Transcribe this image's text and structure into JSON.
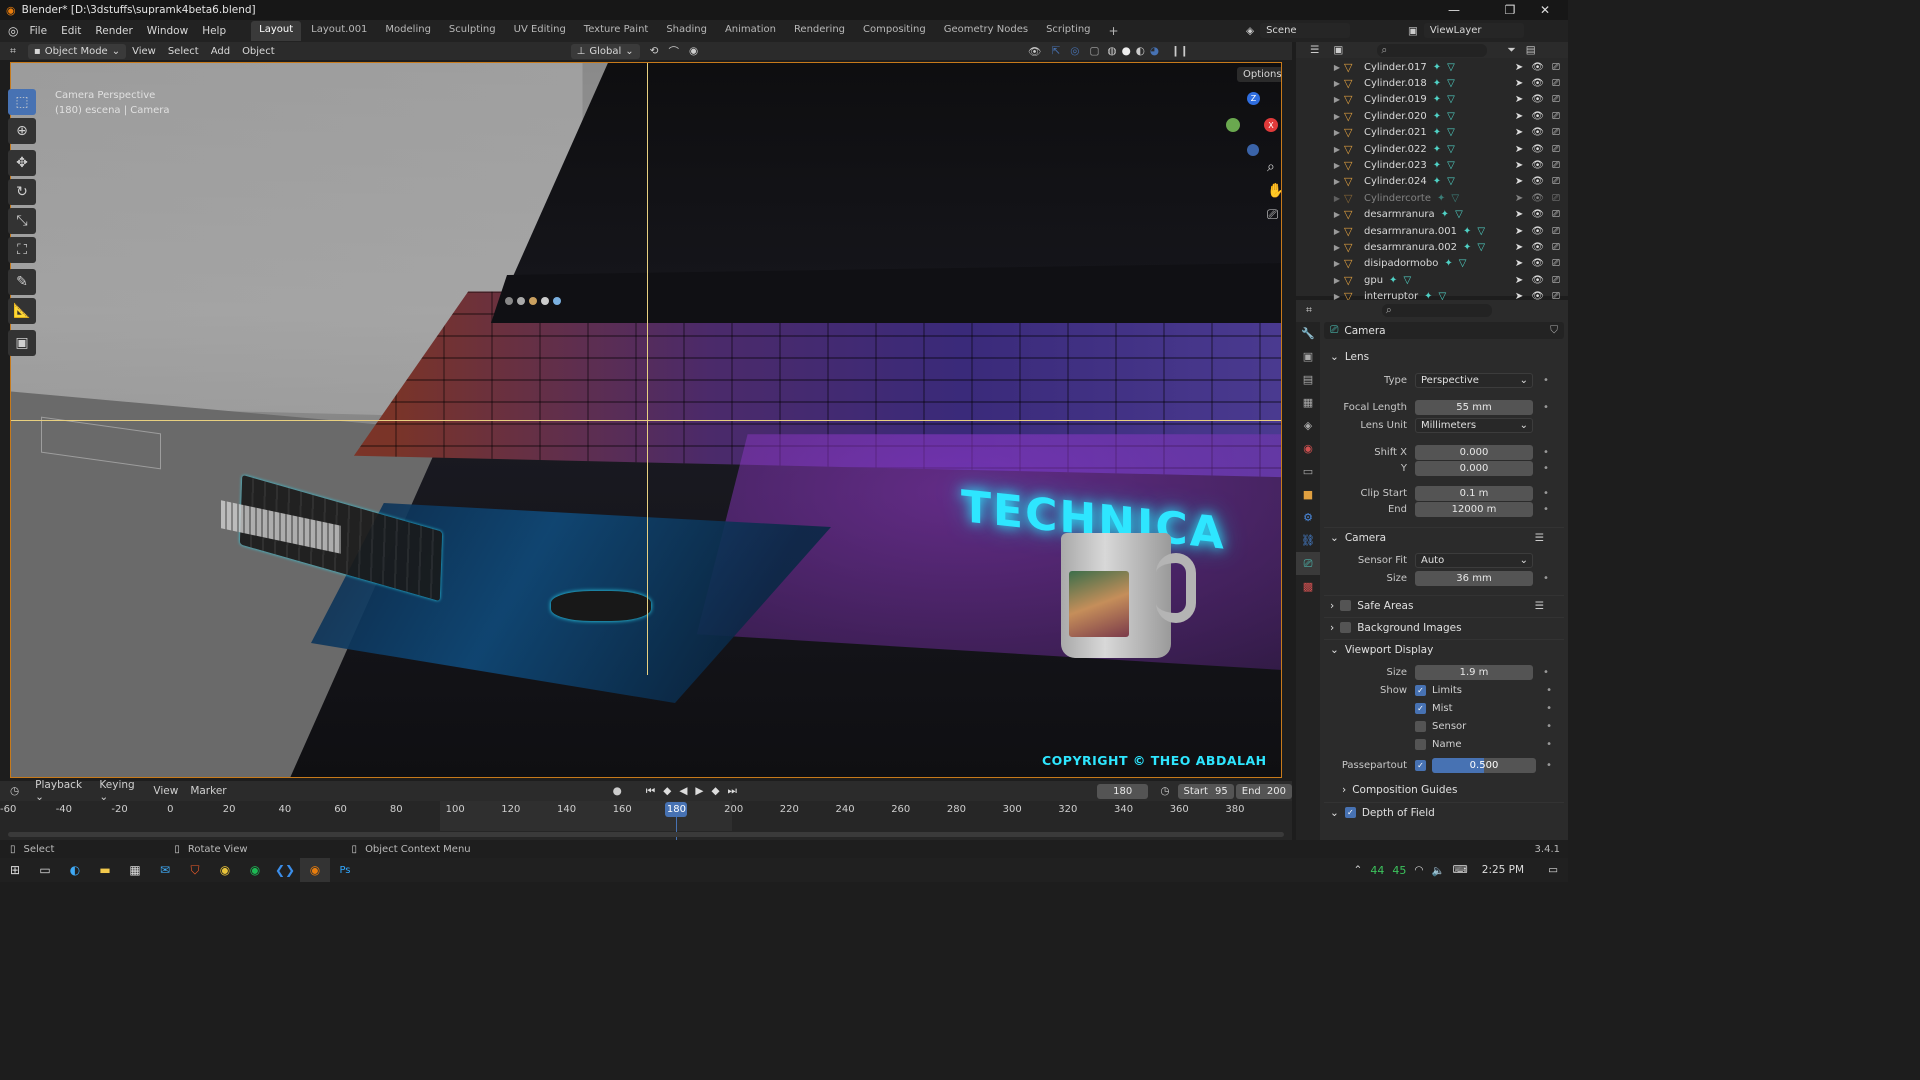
{
  "window": {
    "title": "Blender* [D:\\3dstuffs\\supramk4beta6.blend]"
  },
  "menu": {
    "items": [
      "File",
      "Edit",
      "Render",
      "Window",
      "Help"
    ]
  },
  "workspaces": [
    "Layout",
    "Layout.001",
    "Modeling",
    "Sculpting",
    "UV Editing",
    "Texture Paint",
    "Shading",
    "Animation",
    "Rendering",
    "Compositing",
    "Geometry Nodes",
    "Scripting"
  ],
  "active_workspace": "Layout",
  "scene": {
    "label": "Scene",
    "viewlayer": "ViewLayer"
  },
  "viewport_header": {
    "mode": "Object Mode",
    "menus": [
      "View",
      "Select",
      "Add",
      "Object"
    ],
    "orientation": "Global",
    "options_label": "Options"
  },
  "viewport": {
    "overlay_line1": "Camera Perspective",
    "overlay_line2": "(180) escena | Camera",
    "copyright": "COPYRIGHT © THEO ABDALAH",
    "sign_text": "TECHNICA",
    "gizmo": {
      "z": "Z",
      "x": "X"
    }
  },
  "outliner": {
    "items": [
      {
        "name": "Cylinder.017",
        "dim": false
      },
      {
        "name": "Cylinder.018",
        "dim": false
      },
      {
        "name": "Cylinder.019",
        "dim": false
      },
      {
        "name": "Cylinder.020",
        "dim": false
      },
      {
        "name": "Cylinder.021",
        "dim": false
      },
      {
        "name": "Cylinder.022",
        "dim": false
      },
      {
        "name": "Cylinder.023",
        "dim": false
      },
      {
        "name": "Cylinder.024",
        "dim": false
      },
      {
        "name": "Cylindercorte",
        "dim": true
      },
      {
        "name": "desarmranura",
        "dim": false
      },
      {
        "name": "desarmranura.001",
        "dim": false
      },
      {
        "name": "desarmranura.002",
        "dim": false
      },
      {
        "name": "disipadormobo",
        "dim": false
      },
      {
        "name": "gpu",
        "dim": false
      },
      {
        "name": "interruptor",
        "dim": false
      }
    ]
  },
  "properties": {
    "datablock": "Camera",
    "lens": {
      "header": "Lens",
      "type_label": "Type",
      "type_value": "Perspective",
      "focal_label": "Focal Length",
      "focal_value": "55 mm",
      "lensunit_label": "Lens Unit",
      "lensunit_value": "Millimeters",
      "shiftx_label": "Shift X",
      "shiftx_value": "0.000",
      "shifty_label": "Y",
      "shifty_value": "0.000",
      "clipstart_label": "Clip Start",
      "clipstart_value": "0.1 m",
      "clipend_label": "End",
      "clipend_value": "12000 m"
    },
    "camera": {
      "header": "Camera",
      "sensorfit_label": "Sensor Fit",
      "sensorfit_value": "Auto",
      "size_label": "Size",
      "size_value": "36 mm"
    },
    "safe_areas": "Safe Areas",
    "background_images": "Background Images",
    "viewport_display": {
      "header": "Viewport Display",
      "size_label": "Size",
      "size_value": "1.9 m",
      "show_label": "Show",
      "limits": "Limits",
      "mist": "Mist",
      "sensor": "Sensor",
      "name": "Name",
      "passepartout_label": "Passepartout",
      "passepartout_value": "0.500",
      "passepartout_fraction": 0.5
    },
    "composition_guides": "Composition Guides",
    "depth_of_field": "Depth of Field",
    "version": "3.4.1"
  },
  "timeline": {
    "menus": [
      "Playback",
      "Keying",
      "View",
      "Marker"
    ],
    "current_frame": "180",
    "start_label": "Start",
    "start_value": "95",
    "end_label": "End",
    "end_value": "200",
    "ticks": [
      "-60",
      "-40",
      "-20",
      "0",
      "20",
      "40",
      "60",
      "80",
      "100",
      "120",
      "140",
      "160",
      "180",
      "200",
      "220",
      "240",
      "260",
      "280",
      "300",
      "320",
      "340",
      "360",
      "380"
    ]
  },
  "statusbar": {
    "select": "Select",
    "rotate": "Rotate View",
    "context": "Object Context Menu"
  },
  "taskbar": {
    "time": "2:25 PM",
    "temp1": "44",
    "temp2": "45"
  },
  "colors": {
    "accent": "#4772b3",
    "active_border": "#c77a1b",
    "teal": "#4fd1c5",
    "neon": "#2ee6ff"
  }
}
